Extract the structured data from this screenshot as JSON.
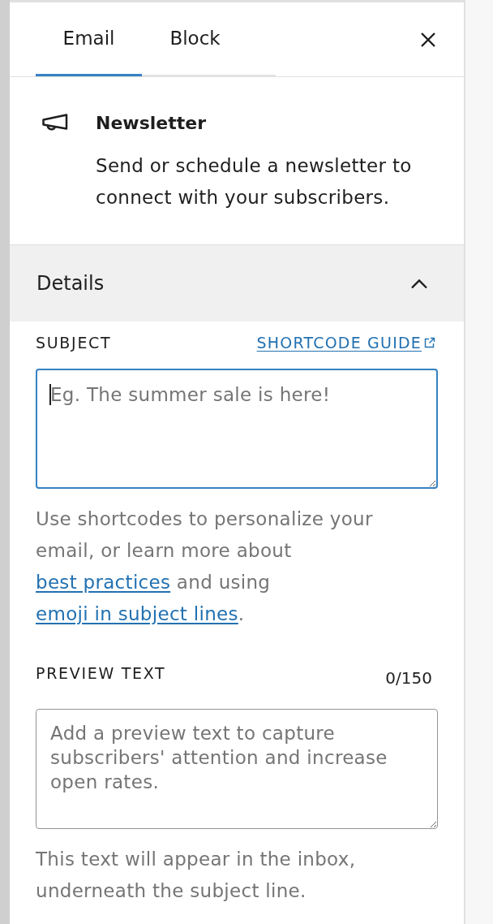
{
  "tabs": [
    {
      "label": "Email",
      "selected": true
    },
    {
      "label": "Block",
      "selected": false
    }
  ],
  "block_card": {
    "title": "Newsletter",
    "description": "Send or schedule a newsletter to connect with your subscribers."
  },
  "panel": {
    "title": "Details",
    "expanded": true,
    "fields": [
      {
        "label": "SUBJECT",
        "link": "SHORTCODE GUIDE",
        "placeholder": "Eg. The summer sale is here!",
        "focused": true,
        "help": [
          {
            "kind": "text",
            "text": "Use shortcodes to personalize your email, or learn more about "
          },
          {
            "kind": "link",
            "text": "best practices"
          },
          {
            "kind": "text",
            "text": " and using "
          },
          {
            "kind": "link",
            "text": "emoji in subject lines"
          },
          {
            "kind": "text",
            "text": "."
          }
        ]
      },
      {
        "label": "PREVIEW TEXT",
        "counter": "0/150",
        "placeholder": "Add a preview text to capture subscribers' attention and increase open rates.",
        "focused": false,
        "help": [
          {
            "kind": "text",
            "text": "This text will appear in the inbox, underneath the subject line."
          }
        ]
      }
    ]
  }
}
